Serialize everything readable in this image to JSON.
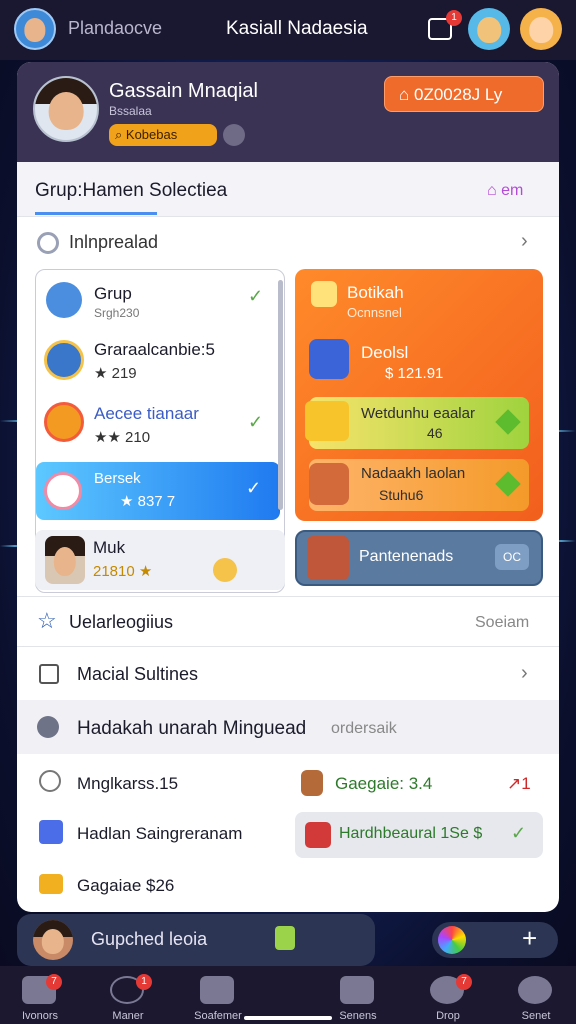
{
  "topbar": {
    "brand": "Plandaocve",
    "title": "Kasiall Nadaesia"
  },
  "header": {
    "user_name": "Gassain Mnaqial",
    "user_sub": "Bssalaa",
    "gold_label": "Kobebas",
    "badge_label": "0Z0028J Ly"
  },
  "section": {
    "title": "Grup:Hamen Solectiea",
    "action": "em"
  },
  "subrow": {
    "label": "Inlnprealad"
  },
  "left_list": [
    {
      "name": "Grup",
      "sub": "Srgh230",
      "check": true
    },
    {
      "name": "Graraalcanbie:5",
      "sub": "★ 219"
    },
    {
      "name": "Aecee tianaar",
      "sub": "★★ 210",
      "check": true
    },
    {
      "name": "Bersek",
      "sub": "★ 837 7",
      "check": true,
      "selected": true
    }
  ],
  "right_card": {
    "title": "Botikah",
    "sub": "Ocnnsnel",
    "item1_title": "Deolsl",
    "item1_val": "$ 121.91",
    "btn1": "Wetdunhu eaalar",
    "btn1_val": "46",
    "btn2": "Nadaakh laolan",
    "btn2_val": "Stuhu6"
  },
  "mini": {
    "name": "Muk",
    "value": "21810 ★"
  },
  "panel_btn": {
    "label": "Pantenenads",
    "icon": "OC"
  },
  "rows": {
    "r1": "Uelarleogiius",
    "r1_right": "Soeiam",
    "r2": "Macial Sultines",
    "r3": "Hadakah unarah Minguead",
    "r3_right": "ordersaik"
  },
  "grid": {
    "a1": "Mnglkarss.15",
    "a2": "Gaegaie: 3.4",
    "a2_val": "↗1",
    "b1": "Hadlan Saingreranam",
    "b2": "Hardhbeaural 1Se $",
    "c1": "Gagaiae $26"
  },
  "chat": {
    "label": "Gupched leoia"
  },
  "nav": [
    {
      "label": "Ivonors",
      "badge": "7"
    },
    {
      "label": "Maner",
      "badge": "1"
    },
    {
      "label": "Soafemer"
    },
    {
      "label": "Senens"
    },
    {
      "label": "Drop",
      "badge": "7"
    },
    {
      "label": "Senet"
    }
  ]
}
